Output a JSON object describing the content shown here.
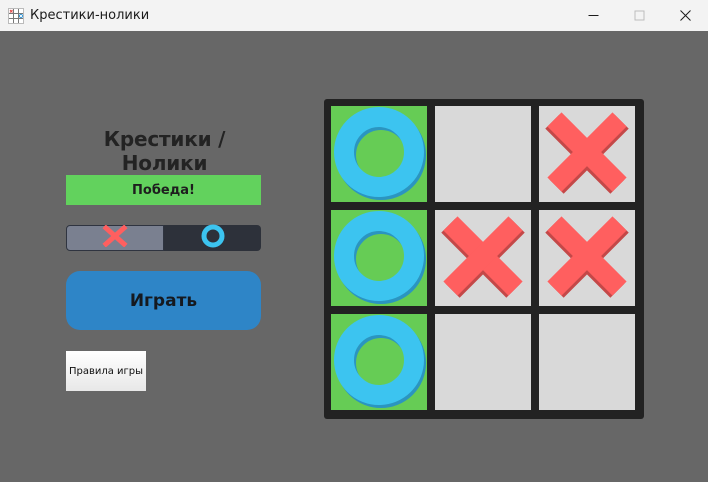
{
  "window": {
    "title": "Крестики-нолики",
    "icon": "tic-tac-toe-icon",
    "controls": [
      "minimize-icon",
      "maximize-icon",
      "close-icon"
    ]
  },
  "game": {
    "heading": "Крестики / Нолики",
    "status": "Победа!",
    "turn_indicator": {
      "x_icon": "cross-icon",
      "o_icon": "ring-icon",
      "active": "o"
    },
    "play_label": "Играть",
    "rules_label": "Правила игры"
  },
  "board": {
    "cells": [
      {
        "mark": "O",
        "winning": true
      },
      {
        "mark": "",
        "winning": false
      },
      {
        "mark": "X",
        "winning": false
      },
      {
        "mark": "O",
        "winning": true
      },
      {
        "mark": "X",
        "winning": false
      },
      {
        "mark": "X",
        "winning": false
      },
      {
        "mark": "O",
        "winning": true
      },
      {
        "mark": "",
        "winning": false
      },
      {
        "mark": "",
        "winning": false
      }
    ]
  },
  "colors": {
    "background": "#676767",
    "cell": "#d9d9d9",
    "win_cell": "#66cc55",
    "x_mark": "#ff5f5f",
    "o_mark": "#3cc4f0",
    "play_button": "#2e85c7",
    "status_bar": "#62d25d"
  }
}
